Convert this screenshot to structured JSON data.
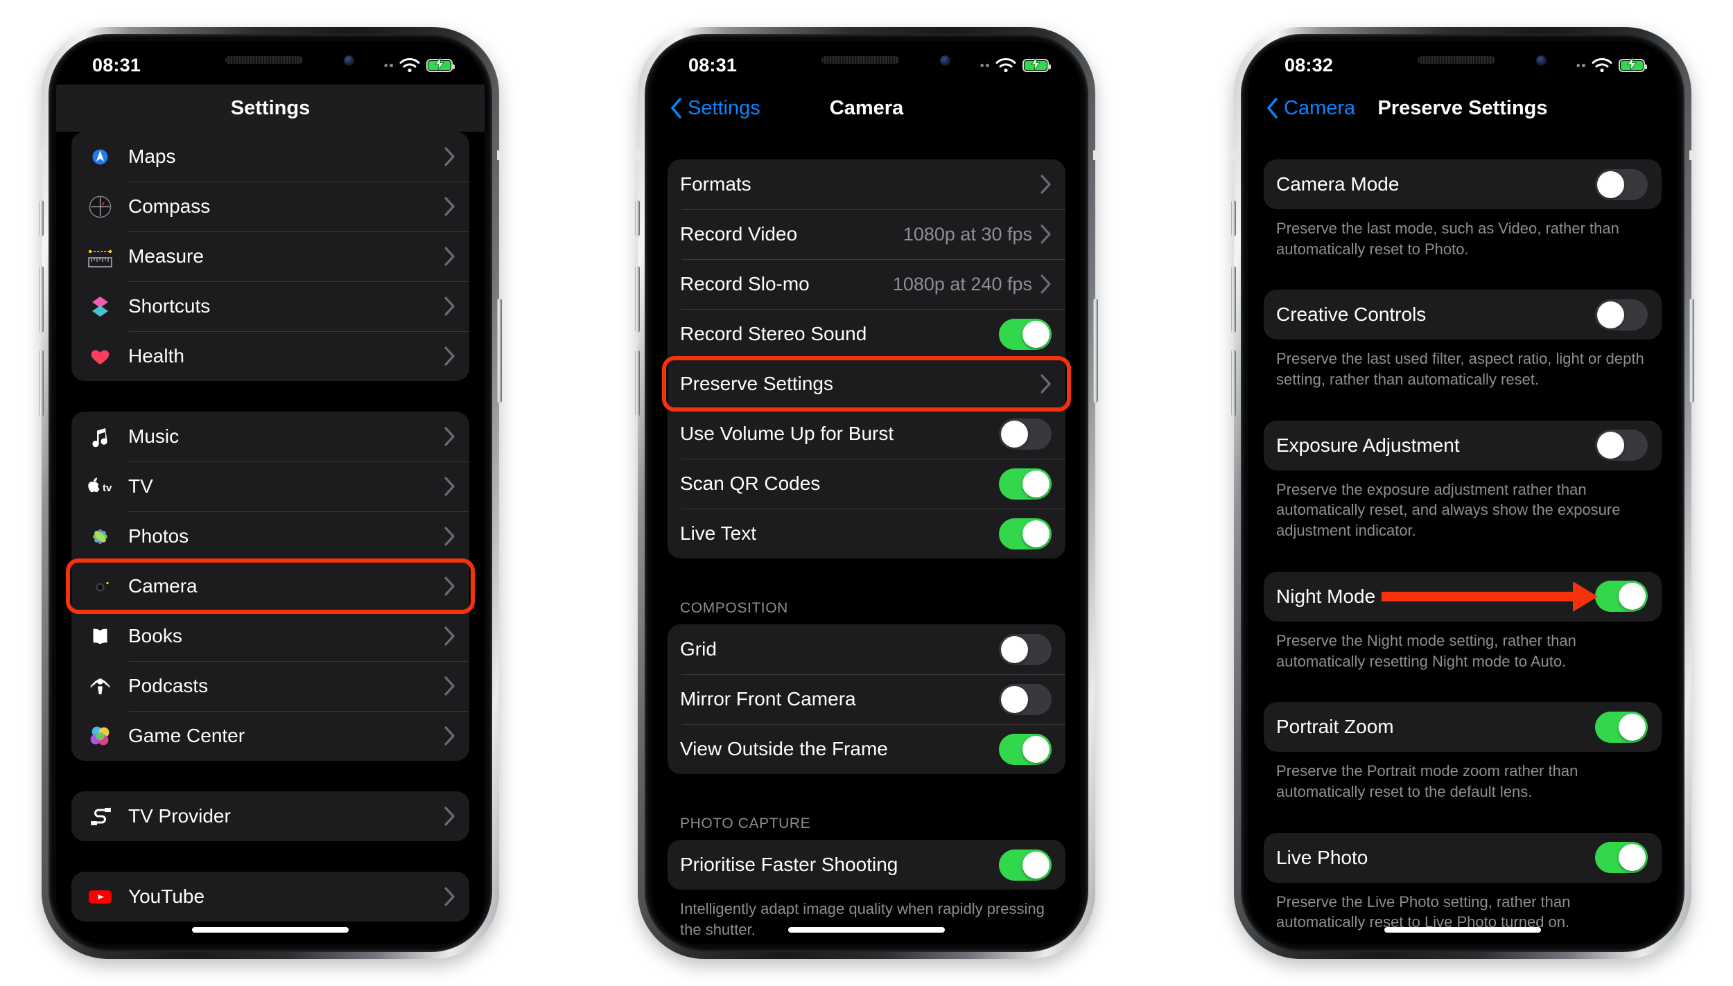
{
  "phones": [
    {
      "id": "settings-list",
      "status": {
        "time": "08:31",
        "wifi": "wifi-icon",
        "battery": "battery-charging-icon"
      },
      "nav": {
        "title": "Settings",
        "back_label": ""
      },
      "groups": [
        {
          "type": "apps",
          "rows": [
            {
              "label": "Maps",
              "icon": "maps-icon",
              "accessory": "chevron"
            },
            {
              "label": "Compass",
              "icon": "compass-icon",
              "accessory": "chevron"
            },
            {
              "label": "Measure",
              "icon": "measure-icon",
              "accessory": "chevron"
            },
            {
              "label": "Shortcuts",
              "icon": "shortcuts-icon",
              "accessory": "chevron"
            },
            {
              "label": "Health",
              "icon": "health-icon",
              "accessory": "chevron"
            }
          ]
        },
        {
          "type": "apps",
          "rows": [
            {
              "label": "Music",
              "icon": "music-icon",
              "accessory": "chevron"
            },
            {
              "label": "TV",
              "icon": "tv-icon",
              "accessory": "chevron"
            },
            {
              "label": "Photos",
              "icon": "photos-icon",
              "accessory": "chevron"
            },
            {
              "label": "Camera",
              "icon": "camera-icon",
              "accessory": "chevron",
              "highlighted": true
            },
            {
              "label": "Books",
              "icon": "books-icon",
              "accessory": "chevron"
            },
            {
              "label": "Podcasts",
              "icon": "podcasts-icon",
              "accessory": "chevron"
            },
            {
              "label": "Game Center",
              "icon": "game-center-icon",
              "accessory": "chevron"
            }
          ]
        },
        {
          "type": "apps",
          "rows": [
            {
              "label": "TV Provider",
              "icon": "tv-provider-icon",
              "accessory": "chevron"
            }
          ]
        },
        {
          "type": "apps",
          "rows": [
            {
              "label": "YouTube",
              "icon": "youtube-icon",
              "accessory": "chevron"
            }
          ]
        }
      ]
    },
    {
      "id": "camera-settings",
      "status": {
        "time": "08:31",
        "wifi": "wifi-icon",
        "battery": "battery-charging-icon"
      },
      "nav": {
        "title": "Camera",
        "back_label": "Settings"
      },
      "groups": [
        {
          "type": "plain",
          "rows": [
            {
              "label": "Formats",
              "accessory": "chevron"
            },
            {
              "label": "Record Video",
              "value": "1080p at 30 fps",
              "accessory": "chevron"
            },
            {
              "label": "Record Slo-mo",
              "value": "1080p at 240 fps",
              "accessory": "chevron"
            },
            {
              "label": "Record Stereo Sound",
              "accessory": "toggle",
              "on": true
            },
            {
              "label": "Preserve Settings",
              "accessory": "chevron",
              "highlighted": true
            },
            {
              "label": "Use Volume Up for Burst",
              "accessory": "toggle",
              "on": false
            },
            {
              "label": "Scan QR Codes",
              "accessory": "toggle",
              "on": true
            },
            {
              "label": "Live Text",
              "accessory": "toggle",
              "on": true
            }
          ]
        },
        {
          "type": "plain",
          "header": "COMPOSITION",
          "rows": [
            {
              "label": "Grid",
              "accessory": "toggle",
              "on": false
            },
            {
              "label": "Mirror Front Camera",
              "accessory": "toggle",
              "on": false
            },
            {
              "label": "View Outside the Frame",
              "accessory": "toggle",
              "on": true
            }
          ]
        },
        {
          "type": "plain",
          "header": "PHOTO CAPTURE",
          "rows": [
            {
              "label": "Prioritise Faster Shooting",
              "accessory": "toggle",
              "on": true
            }
          ],
          "footnote": "Intelligently adapt image quality when rapidly pressing the shutter."
        }
      ]
    },
    {
      "id": "preserve-settings",
      "status": {
        "time": "08:32",
        "wifi": "wifi-icon",
        "battery": "battery-charging-icon"
      },
      "nav": {
        "title": "Preserve Settings",
        "back_label": "Camera"
      },
      "groups": [
        {
          "type": "plain",
          "rows": [
            {
              "label": "Camera Mode",
              "accessory": "toggle",
              "on": false
            }
          ],
          "footnote": "Preserve the last mode, such as Video, rather than automatically reset to Photo."
        },
        {
          "type": "plain",
          "rows": [
            {
              "label": "Creative Controls",
              "accessory": "toggle",
              "on": false
            }
          ],
          "footnote": "Preserve the last used filter, aspect ratio, light or depth setting, rather than automatically reset."
        },
        {
          "type": "plain",
          "rows": [
            {
              "label": "Exposure Adjustment",
              "accessory": "toggle",
              "on": false
            }
          ],
          "footnote": "Preserve the exposure adjustment rather than automatically reset, and always show the exposure adjustment indicator."
        },
        {
          "type": "plain",
          "rows": [
            {
              "label": "Night Mode",
              "accessory": "toggle",
              "on": true,
              "arrow": true
            }
          ],
          "footnote": "Preserve the Night mode setting, rather than automatically resetting Night mode to Auto."
        },
        {
          "type": "plain",
          "rows": [
            {
              "label": "Portrait Zoom",
              "accessory": "toggle",
              "on": true
            }
          ],
          "footnote": "Preserve the Portrait mode zoom rather than automatically reset to the default lens."
        },
        {
          "type": "plain",
          "rows": [
            {
              "label": "Live Photo",
              "accessory": "toggle",
              "on": true
            }
          ],
          "footnote": "Preserve the Live Photo setting, rather than automatically reset to Live Photo turned on."
        }
      ]
    }
  ],
  "colors": {
    "annotation_red": "#f5320c",
    "accent_blue": "#0a84ff",
    "toggle_on_green": "#32d74b",
    "group_bg": "#1c1c1e",
    "screen_bg": "#000000",
    "secondary_text": "#8e8e93"
  }
}
